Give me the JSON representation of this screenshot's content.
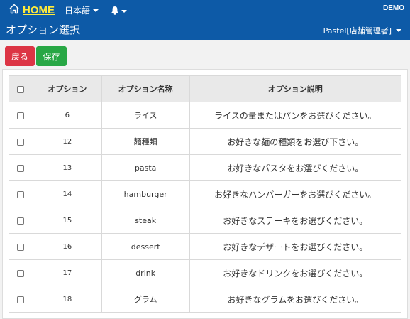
{
  "header": {
    "home_label": "HOME",
    "language": "日本語",
    "env_badge": "DEMO",
    "page_title": "オプション選択",
    "user": "Pastel[店舗管理者]"
  },
  "toolbar": {
    "back_label": "戻る",
    "save_label": "保存"
  },
  "table": {
    "headers": [
      "オプション",
      "オプション名称",
      "オプション説明"
    ],
    "rows": [
      {
        "id": "6",
        "name": "ライス",
        "desc": "ライスの量またはパンをお選びください。"
      },
      {
        "id": "12",
        "name": "麺種類",
        "desc": "お好きな麺の種類をお選び下さい。"
      },
      {
        "id": "13",
        "name": "pasta",
        "desc": "お好きなパスタをお選びください。"
      },
      {
        "id": "14",
        "name": "hamburger",
        "desc": "お好きなハンバーガーをお選びください。"
      },
      {
        "id": "15",
        "name": "steak",
        "desc": "お好きなステーキをお選びください。"
      },
      {
        "id": "16",
        "name": "dessert",
        "desc": "お好きなデザートをお選びください。"
      },
      {
        "id": "17",
        "name": "drink",
        "desc": "お好きなドリンクをお選びください。"
      },
      {
        "id": "18",
        "name": "グラム",
        "desc": "お好きなグラムをお選びください。"
      }
    ]
  },
  "colors": {
    "header_bg": "#0d5aa7",
    "home_link": "#ffeb3b",
    "back_button": "#dc3545",
    "save_button": "#28a745"
  },
  "icons": {
    "home": "home-icon",
    "language_caret": "chevron-down-icon",
    "notifications": "bell-icon",
    "user_caret": "chevron-down-icon"
  }
}
